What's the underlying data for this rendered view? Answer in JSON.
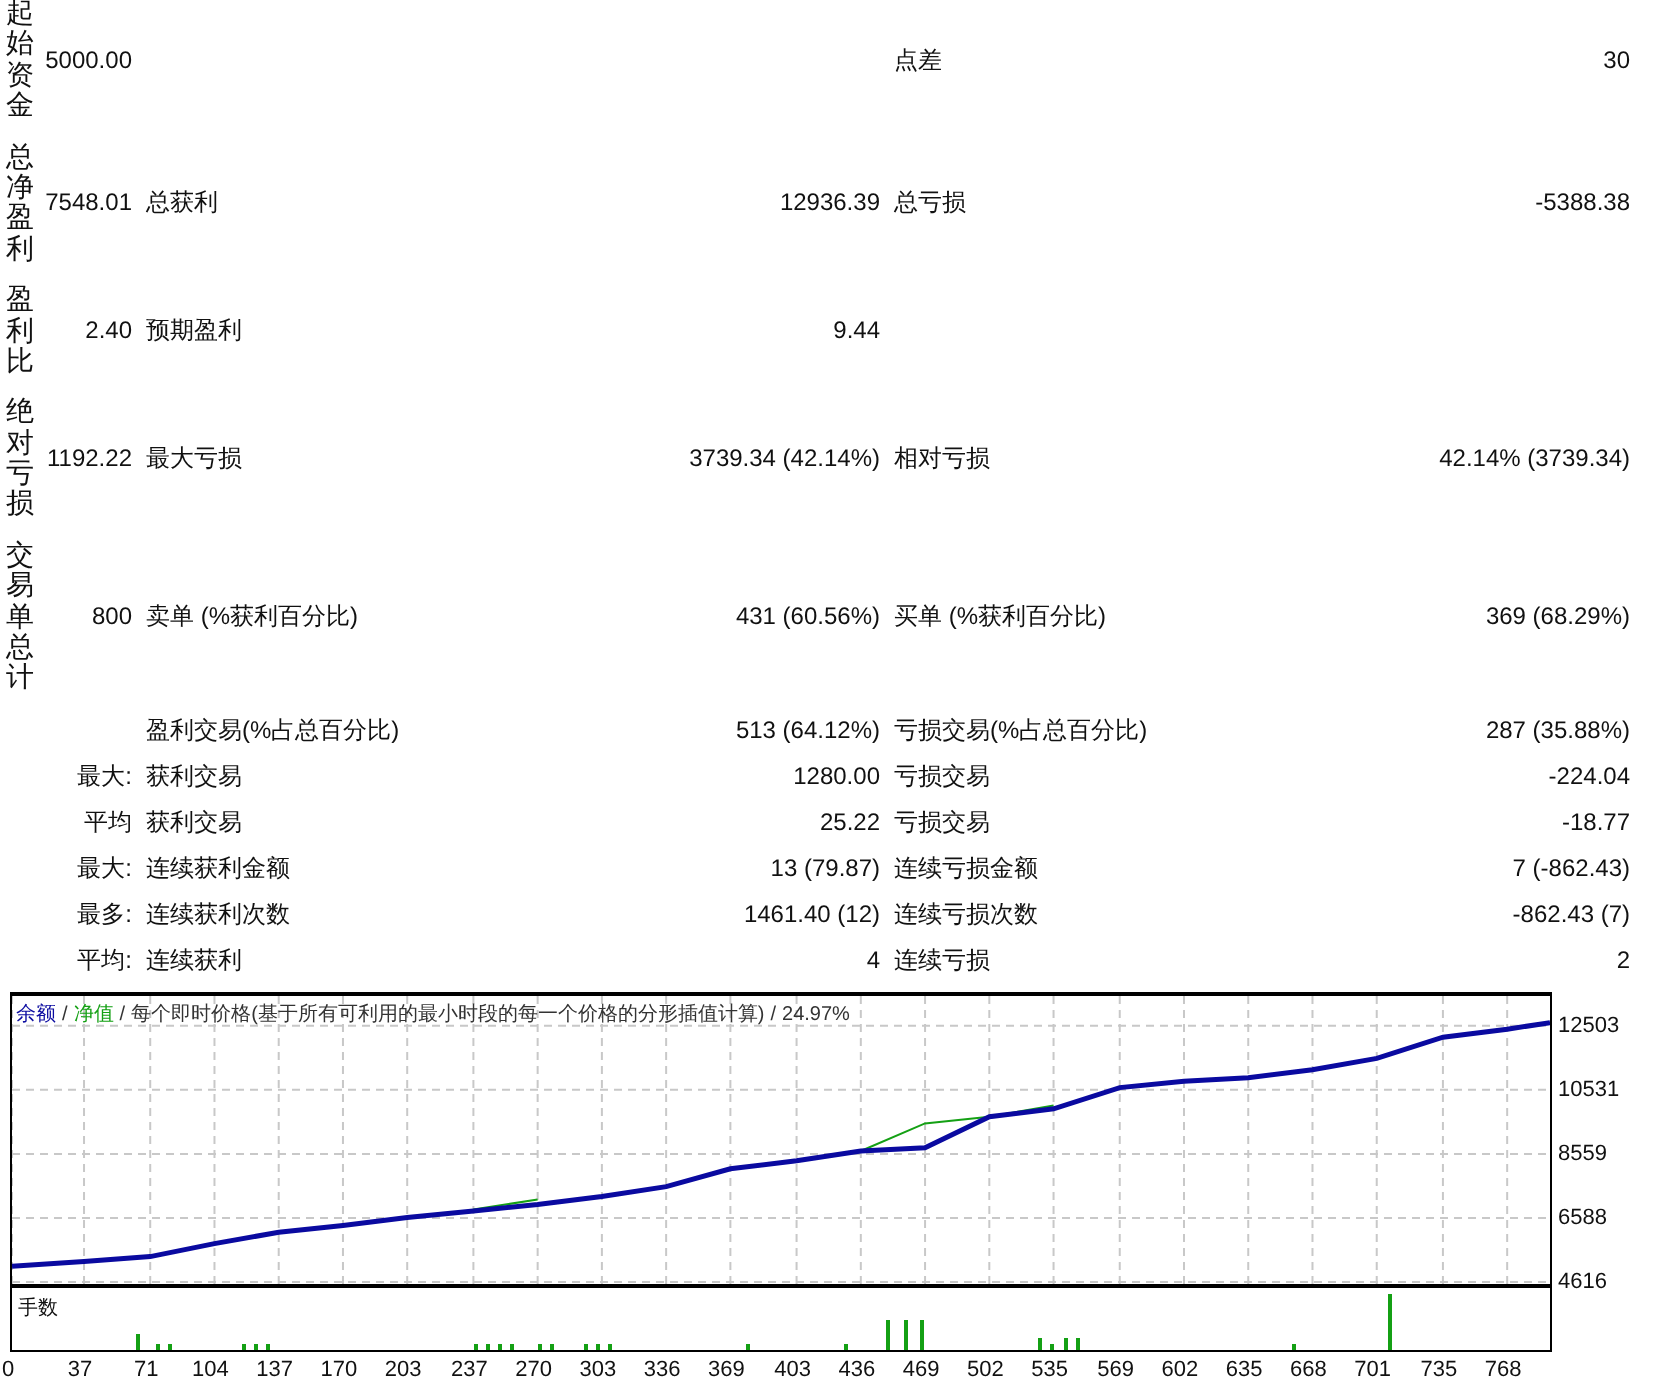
{
  "summary": [
    {
      "label": "起始资金",
      "value": "5000.00",
      "right": {
        "label": "点差",
        "value": "30"
      }
    },
    {
      "label": "总净盈利",
      "value": "7548.01",
      "left": {
        "label": "总获利",
        "value": "12936.39"
      },
      "right": {
        "label": "总亏损",
        "value": "-5388.38"
      }
    },
    {
      "label": "盈利比",
      "value": "2.40",
      "left": {
        "label": "预期盈利",
        "value": "9.44"
      }
    },
    {
      "label": "绝对亏损",
      "value": "1192.22",
      "left": {
        "label": "最大亏损",
        "value": "3739.34 (42.14%)"
      },
      "right": {
        "label": "相对亏损",
        "value": "42.14% (3739.34)"
      }
    },
    {
      "label": "交易单总计",
      "value": "800",
      "left": {
        "label": "卖单 (%获利百分比)",
        "value": "431 (60.56%)"
      },
      "right": {
        "label": "买单 (%获利百分比)",
        "value": "369 (68.29%)"
      }
    }
  ],
  "details": [
    {
      "left": {
        "label": "盈利交易(%占总百分比)",
        "value": "513 (64.12%)"
      },
      "right": {
        "label": "亏损交易(%占总百分比)",
        "value": "287 (35.88%)"
      }
    },
    {
      "prefix": "最大:",
      "left": {
        "label": "获利交易",
        "value": "1280.00"
      },
      "right": {
        "label": "亏损交易",
        "value": "-224.04"
      }
    },
    {
      "prefix": "平均",
      "left": {
        "label": "获利交易",
        "value": "25.22"
      },
      "right": {
        "label": "亏损交易",
        "value": "-18.77"
      }
    },
    {
      "prefix": "最大:",
      "left": {
        "label": "连续获利金额",
        "value": "13 (79.87)"
      },
      "right": {
        "label": "连续亏损金额",
        "value": "7 (-862.43)"
      }
    },
    {
      "prefix": "最多:",
      "left": {
        "label": "连续获利次数",
        "value": "1461.40 (12)"
      },
      "right": {
        "label": "连续亏损次数",
        "value": "-862.43 (7)"
      }
    },
    {
      "prefix": "平均:",
      "left": {
        "label": "连续获利",
        "value": "4"
      },
      "right": {
        "label": "连续亏损",
        "value": "2"
      }
    }
  ],
  "chart": {
    "legend_separators": [
      "/",
      "/",
      "/"
    ],
    "description": "每个即时价格(基于所有可利用的最小时段的每一个价格的分形插值计算)",
    "quality": "24.97%",
    "chart_data": {
      "type": "line",
      "x": [
        0,
        37,
        71,
        104,
        137,
        170,
        203,
        237,
        270,
        303,
        336,
        369,
        403,
        436,
        469,
        502,
        535,
        569,
        602,
        635,
        668,
        701,
        735,
        768,
        790
      ],
      "grid": true,
      "series": [
        {
          "name": "余额",
          "color": "#0a0aa0",
          "values": [
            5100,
            5250,
            5400,
            5800,
            6150,
            6350,
            6600,
            6800,
            7000,
            7250,
            7550,
            8100,
            8350,
            8650,
            8750,
            9700,
            9950,
            10600,
            10800,
            10900,
            11150,
            11500,
            12150,
            12400,
            12600
          ]
        },
        {
          "name": "净值",
          "color": "#14a014",
          "values": [
            null,
            null,
            null,
            null,
            null,
            null,
            null,
            6850,
            7150,
            null,
            null,
            null,
            null,
            8650,
            9500,
            9700,
            10050,
            null,
            null,
            null,
            null,
            null,
            null,
            null,
            null
          ]
        }
      ],
      "xlim": [
        0,
        790
      ],
      "ylim": [
        4616,
        13420
      ],
      "xticks": [
        0,
        37,
        71,
        104,
        137,
        170,
        203,
        237,
        270,
        303,
        336,
        369,
        403,
        436,
        469,
        502,
        535,
        569,
        602,
        635,
        668,
        701,
        735,
        768
      ],
      "yticks": [
        4616,
        6588,
        8559,
        10531,
        12503
      ]
    },
    "lots_label": "手数"
  }
}
